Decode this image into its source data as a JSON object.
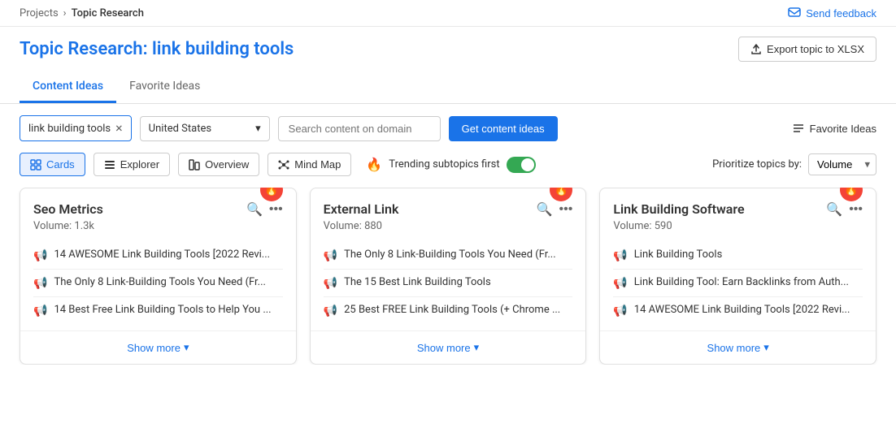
{
  "breadcrumb": {
    "projects_label": "Projects",
    "separator": "›",
    "current": "Topic Research"
  },
  "header": {
    "title_static": "Topic Research:",
    "title_dynamic": "link building tools",
    "export_label": "Export topic to XLSX",
    "send_feedback_label": "Send feedback"
  },
  "tabs": [
    {
      "id": "content-ideas",
      "label": "Content Ideas",
      "active": true
    },
    {
      "id": "favorite-ideas",
      "label": "Favorite Ideas",
      "active": false
    }
  ],
  "toolbar": {
    "search_chip_value": "link building tools",
    "country_value": "United States",
    "domain_placeholder": "Search content on domain",
    "get_ideas_label": "Get content ideas",
    "favorite_ideas_label": "Favorite Ideas"
  },
  "view_toolbar": {
    "views": [
      {
        "id": "cards",
        "label": "Cards",
        "active": true,
        "icon": "cards-icon"
      },
      {
        "id": "explorer",
        "label": "Explorer",
        "active": false,
        "icon": "explorer-icon"
      },
      {
        "id": "overview",
        "label": "Overview",
        "active": false,
        "icon": "overview-icon"
      },
      {
        "id": "mind-map",
        "label": "Mind Map",
        "active": false,
        "icon": "mind-map-icon"
      }
    ],
    "trending_label": "Trending subtopics first",
    "trending_on": true,
    "prioritize_label": "Prioritize topics by:",
    "prioritize_value": "Volume"
  },
  "cards": [
    {
      "id": "seo-metrics",
      "title": "Seo Metrics",
      "volume": "Volume: 1.3k",
      "trending": true,
      "items": [
        "14 AWESOME Link Building Tools [2022 Revi...",
        "The Only 8 Link-Building Tools You Need (Fr...",
        "14 Best Free Link Building Tools to Help You ..."
      ],
      "show_more": "Show more"
    },
    {
      "id": "external-link",
      "title": "External Link",
      "volume": "Volume: 880",
      "trending": true,
      "items": [
        "The Only 8 Link-Building Tools You Need (Fr...",
        "The 15 Best Link Building Tools",
        "25 Best FREE Link Building Tools (+ Chrome ..."
      ],
      "show_more": "Show more"
    },
    {
      "id": "link-building-software",
      "title": "Link Building Software",
      "volume": "Volume: 590",
      "trending": true,
      "items": [
        "Link Building Tools",
        "Link Building Tool: Earn Backlinks from Auth...",
        "14 AWESOME Link Building Tools [2022 Revi..."
      ],
      "show_more": "Show more"
    }
  ],
  "icons": {
    "chevron_down": "▾",
    "fire": "🔥",
    "search": "🔍",
    "dots": "⋯",
    "megaphone": "📢",
    "list": "≡",
    "export": "⬆",
    "flag": "💬"
  }
}
